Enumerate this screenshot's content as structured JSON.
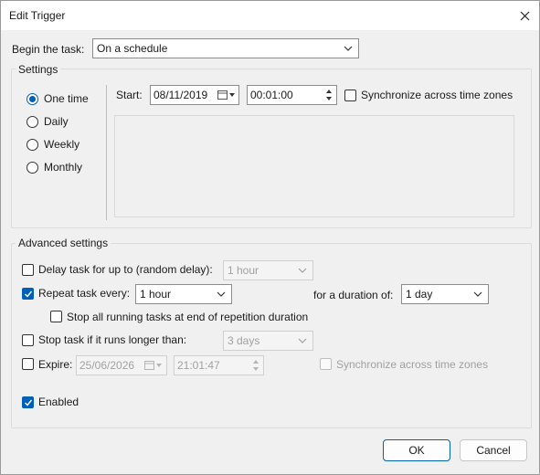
{
  "window": {
    "title": "Edit Trigger"
  },
  "begin": {
    "label": "Begin the task:",
    "value": "On a schedule"
  },
  "settings": {
    "legend": "Settings",
    "options": [
      "One time",
      "Daily",
      "Weekly",
      "Monthly"
    ],
    "selected": "One time",
    "start_label": "Start:",
    "start_date": "08/11/2019",
    "start_time": "00:01:00",
    "sync_label": "Synchronize across time zones"
  },
  "advanced": {
    "legend": "Advanced settings",
    "delay_label": "Delay task for up to (random delay):",
    "delay_value": "1 hour",
    "repeat_label": "Repeat task every:",
    "repeat_value": "1 hour",
    "duration_label": "for a duration of:",
    "duration_value": "1 day",
    "stop_all_label": "Stop all running tasks at end of repetition duration",
    "stop_longer_label": "Stop task if it runs longer than:",
    "stop_longer_value": "3 days",
    "expire_label": "Expire:",
    "expire_date": "25/06/2026",
    "expire_time": "21:01:47",
    "expire_sync_label": "Synchronize across time zones",
    "enabled_label": "Enabled"
  },
  "buttons": {
    "ok": "OK",
    "cancel": "Cancel"
  },
  "state": {
    "delay_checked": false,
    "repeat_checked": true,
    "stop_all_checked": false,
    "stop_longer_checked": false,
    "expire_checked": false,
    "enabled_checked": true,
    "sync_checked": false
  },
  "colors": {
    "accent": "#005fb8",
    "dialog_bg": "#f0f0f0"
  }
}
